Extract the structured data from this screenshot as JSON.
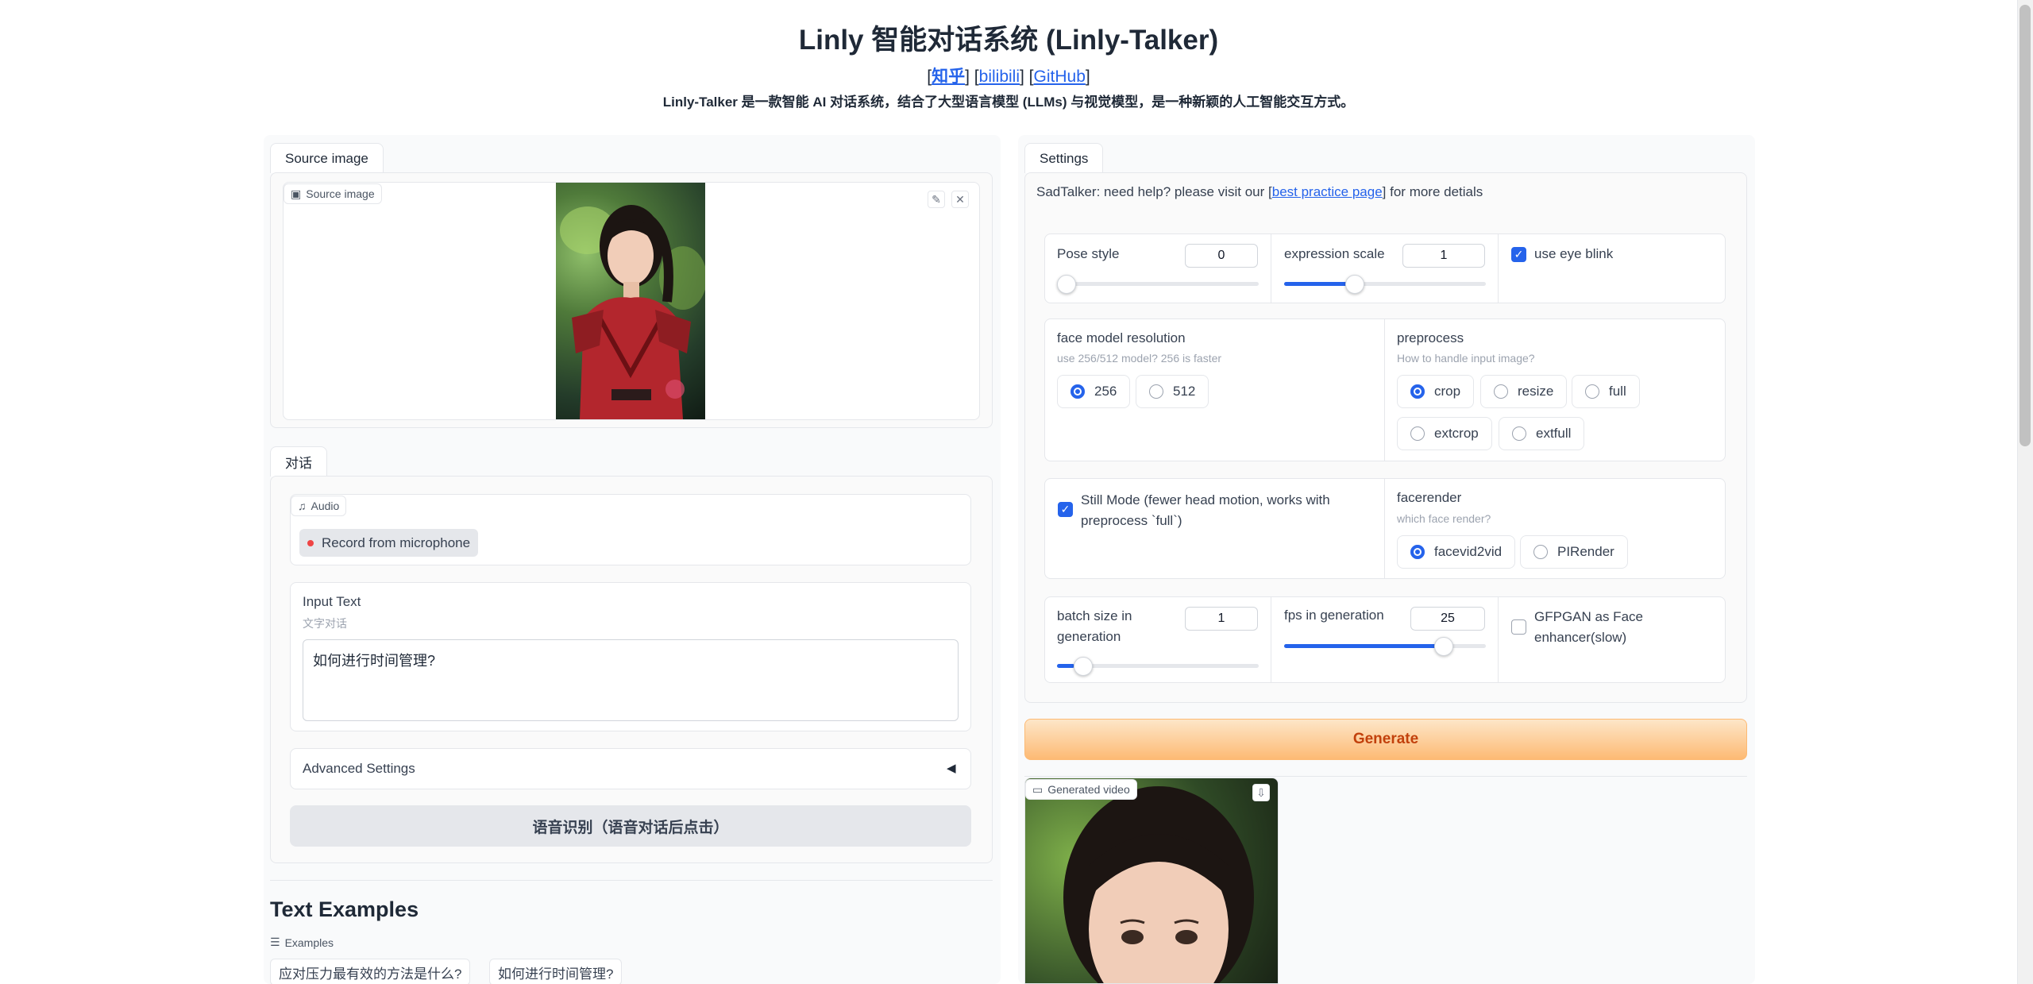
{
  "header": {
    "title": "Linly 智能对话系统 (Linly-Talker)",
    "links": [
      "知乎",
      "bilibili",
      "GitHub"
    ],
    "description": "Linly-Talker 是一款智能 AI 对话系统，结合了大型语言模型 (LLMs) 与视觉模型，是一种新颖的人工智能交互方式。"
  },
  "left": {
    "source_tab": "Source image",
    "source_chip": "Source image",
    "chat_tab": "对话",
    "audio_chip": "Audio",
    "record_label": "Record from microphone",
    "input_label": "Input Text",
    "input_sublabel": "文字对话",
    "input_value": "如何进行时间管理?",
    "advanced_label": "Advanced Settings",
    "asr_button": "语音识别（语音对话后点击）",
    "examples_title": "Text Examples",
    "examples_chip": "Examples",
    "examples": [
      "应对压力最有效的方法是什么?",
      "如何进行时间管理?"
    ]
  },
  "settings": {
    "tab": "Settings",
    "help_prefix": "SadTalker: need help? please visit our ",
    "help_link": "best practice page",
    "help_suffix": " for more detials",
    "pose_style": {
      "label": "Pose style",
      "value": "0",
      "fraction": 0.0
    },
    "expression_scale": {
      "label": "expression scale",
      "value": "1",
      "fraction": 0.33
    },
    "eye_blink": {
      "label": "use eye blink",
      "checked": true
    },
    "face_res": {
      "label": "face model resolution",
      "sublabel": "use 256/512 model? 256 is faster",
      "options": [
        "256",
        "512"
      ],
      "selected": "256"
    },
    "preprocess": {
      "label": "preprocess",
      "sublabel": "How to handle input image?",
      "options": [
        "crop",
        "resize",
        "full",
        "extcrop",
        "extfull"
      ],
      "selected": "crop"
    },
    "still_mode": {
      "label": "Still Mode (fewer head motion, works with preprocess `full`)",
      "checked": true
    },
    "facerender": {
      "label": "facerender",
      "sublabel": "which face render?",
      "options": [
        "facevid2vid",
        "PIRender"
      ],
      "selected": "facevid2vid"
    },
    "batch_size": {
      "label": "batch size in generation",
      "value": "1",
      "fraction": 0.0
    },
    "fps": {
      "label": "fps in generation",
      "value": "25",
      "fraction": 0.8
    },
    "gfpgan": {
      "label": "GFPGAN as Face enhancer(slow)",
      "checked": false
    },
    "generate_button": "Generate",
    "video_chip": "Generated video"
  },
  "colors": {
    "accent": "#2563eb",
    "generate": "#fdba74"
  }
}
